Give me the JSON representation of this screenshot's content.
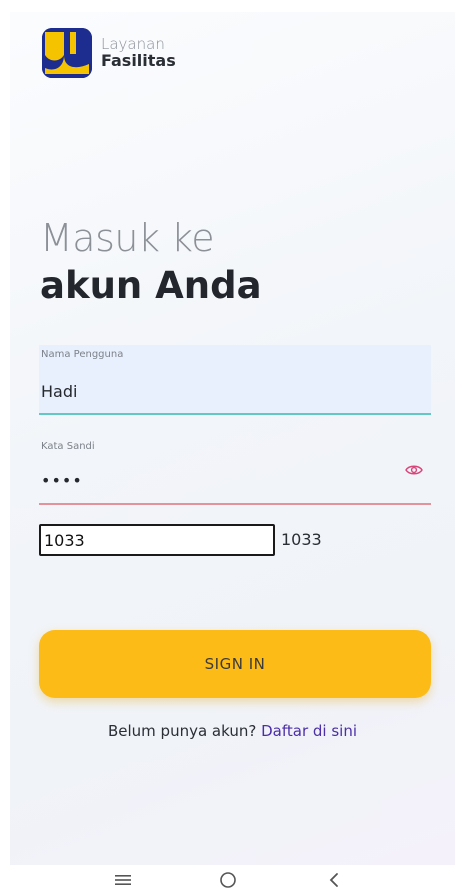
{
  "app": {
    "brand_line1": "Layanan",
    "brand_line2": "Fasilitas",
    "logo_icon": "pu-logo-icon"
  },
  "heading": {
    "line1": "Masuk ke",
    "line2": "akun Anda"
  },
  "form": {
    "username": {
      "label": "Nama Pengguna",
      "value": "Hadi"
    },
    "password": {
      "label": "Kata Sandi",
      "value": "••••",
      "toggle_icon": "eye-icon"
    },
    "captcha": {
      "input_value": "1033",
      "code": "1033"
    },
    "signin_label": "SIGN IN"
  },
  "register": {
    "prompt": "Belum punya akun?",
    "link_label": "Daftar di sini"
  },
  "nav": {
    "recent_icon": "menu-icon",
    "home_icon": "home-circle-icon",
    "back_icon": "back-chevron-icon"
  },
  "colors": {
    "accent": "#fcbb16",
    "link": "#4b2ea8",
    "username_underline": "#63c8c1",
    "password_underline": "#e3929c",
    "logo_blue": "#1c2c8f",
    "logo_yellow": "#f6c300"
  }
}
